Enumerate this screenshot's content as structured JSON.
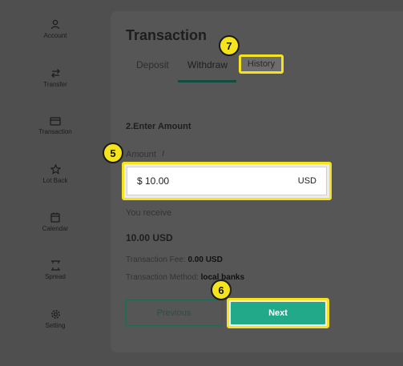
{
  "sidebar": {
    "items": [
      {
        "label": "Account",
        "icon": "user-icon"
      },
      {
        "label": "Transfer",
        "icon": "transfer-icon"
      },
      {
        "label": "Transaction",
        "icon": "card-icon"
      },
      {
        "label": "Lot Back",
        "icon": "star-icon"
      },
      {
        "label": "Calendar",
        "icon": "calendar-icon"
      },
      {
        "label": "Spread",
        "icon": "spread-icon"
      },
      {
        "label": "Setting",
        "icon": "gear-icon"
      }
    ]
  },
  "page": {
    "title": "Transaction",
    "tabs": [
      {
        "label": "Deposit"
      },
      {
        "label": "Withdraw",
        "active": true
      },
      {
        "label": "History"
      }
    ]
  },
  "form": {
    "section_title": "2.Enter Amount",
    "amount_label": "Amount",
    "amount_value": "$ 10.00",
    "amount_currency": "USD",
    "receive_label": "You receive",
    "receive_value": "10.00 USD",
    "fee_label": "Transaction Fee:",
    "fee_value": "0.00 USD",
    "method_label": "Transaction Method:",
    "method_value": "local banks"
  },
  "buttons": {
    "previous": "Previous",
    "next": "Next"
  },
  "annotations": {
    "badge_5": "5",
    "badge_6": "6",
    "badge_7": "7"
  },
  "colors": {
    "accent": "#21a98a",
    "highlight": "#f5e31d",
    "tab_underline": "#134c3e"
  }
}
